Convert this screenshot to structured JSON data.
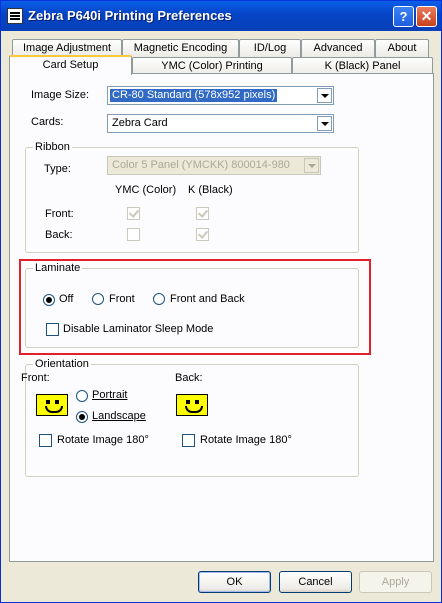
{
  "window": {
    "title": "Zebra P640i Printing Preferences",
    "help_label": "?",
    "close_label": "✕"
  },
  "tabs_row1": [
    "Image Adjustment",
    "Magnetic Encoding",
    "ID/Log",
    "Advanced",
    "About"
  ],
  "tabs_row2": [
    "Card Setup",
    "YMC (Color) Printing",
    "K (Black) Panel"
  ],
  "image_size": {
    "label": "Image Size:",
    "value": "CR-80 Standard (578x952 pixels)"
  },
  "cards": {
    "label": "Cards:",
    "value": "Zebra Card"
  },
  "ribbon": {
    "title": "Ribbon",
    "type_label": "Type:",
    "type_value": "Color 5 Panel (YMCKK) 800014-980",
    "col_ymc": "YMC (Color)",
    "col_k": "K (Black)",
    "front_label": "Front:",
    "back_label": "Back:",
    "front_ymc_checked": true,
    "front_k_checked": true,
    "back_ymc_checked": false,
    "back_k_checked": true
  },
  "laminate": {
    "title": "Laminate",
    "options": [
      "Off",
      "Front",
      "Front and Back"
    ],
    "selected": "Off",
    "sleep_label": "Disable Laminator Sleep Mode",
    "sleep_checked": false
  },
  "orientation": {
    "title": "Orientation",
    "front_label": "Front:",
    "back_label": "Back:",
    "portrait_label": "Portrait",
    "landscape_label": "Landscape",
    "selected": "Landscape",
    "rotate_front_label": "Rotate Image 180°",
    "rotate_back_label": "Rotate Image 180°"
  },
  "buttons": {
    "ok": "OK",
    "cancel": "Cancel",
    "apply": "Apply"
  },
  "colors": {
    "titlebar": "#0A5FE8",
    "highlight": "#E0212A",
    "selection": "#316AC5",
    "face": "#ECE9D8"
  }
}
